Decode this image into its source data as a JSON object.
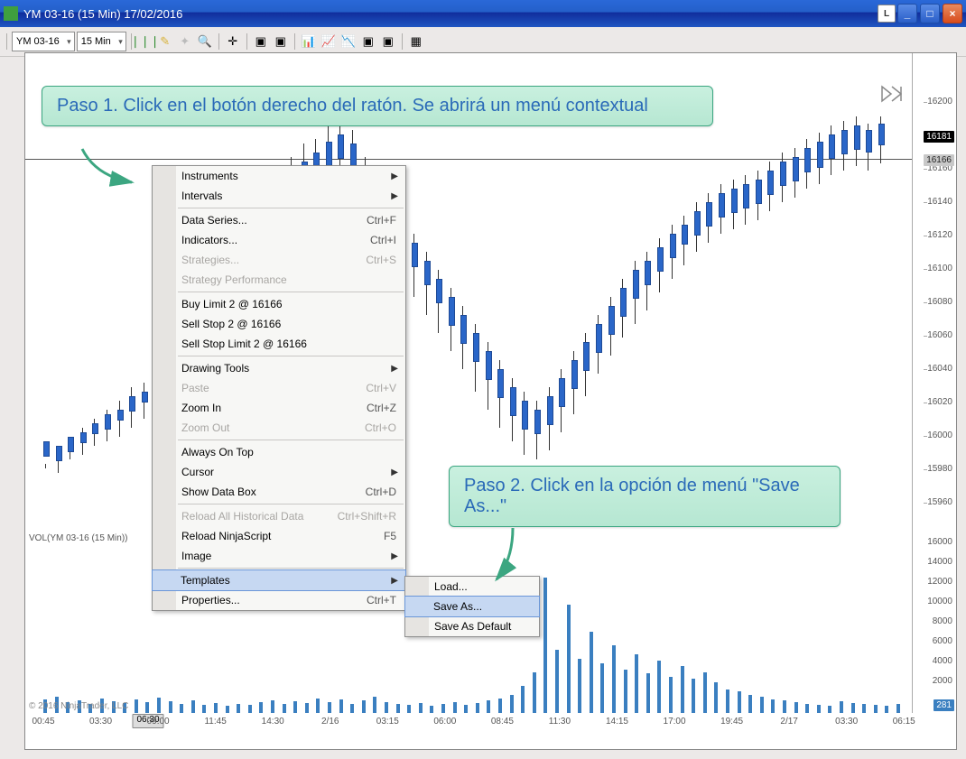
{
  "title": "YM 03-16 (15 Min)  17/02/2016",
  "l_button": "L",
  "toolbar": {
    "instrument": "YM 03-16",
    "interval": "15 Min"
  },
  "chart": {
    "price_current": "16181",
    "price_line": "16166",
    "vol_current": "281",
    "vol_title": "VOL(YM 03-16 (15 Min))",
    "copyright": "© 2016 NinjaTrader, LLC"
  },
  "y_ticks": [
    "16200",
    "16180",
    "16160",
    "16140",
    "16120",
    "16100",
    "16080",
    "16060",
    "16040",
    "16020",
    "16000",
    "15980",
    "15960"
  ],
  "vol_ticks": [
    "16000",
    "14000",
    "12000",
    "10000",
    "8000",
    "6000",
    "4000",
    "2000"
  ],
  "x_ticks": [
    "00:45",
    "03:30",
    "09:00",
    "11:45",
    "14:30",
    "2/16",
    "03:15",
    "06:00",
    "08:45",
    "11:30",
    "14:15",
    "17:00",
    "19:45",
    "2/17",
    "03:30",
    "06:15"
  ],
  "x_cursor": "06:30",
  "menu": {
    "items": [
      {
        "label": "Instruments",
        "arrow": true
      },
      {
        "label": "Intervals",
        "arrow": true
      },
      {
        "sep": true
      },
      {
        "label": "Data Series...",
        "sc": "Ctrl+F"
      },
      {
        "label": "Indicators...",
        "sc": "Ctrl+I"
      },
      {
        "label": "Strategies...",
        "sc": "Ctrl+S",
        "disabled": true
      },
      {
        "label": "Strategy Performance",
        "disabled": true
      },
      {
        "sep": true
      },
      {
        "label": "Buy Limit 2 @ 16166"
      },
      {
        "label": "Sell Stop 2 @ 16166"
      },
      {
        "label": "Sell Stop Limit 2 @ 16166"
      },
      {
        "sep": true
      },
      {
        "label": "Drawing Tools",
        "arrow": true
      },
      {
        "label": "Paste",
        "sc": "Ctrl+V",
        "disabled": true
      },
      {
        "label": "Zoom In",
        "sc": "Ctrl+Z"
      },
      {
        "label": "Zoom Out",
        "sc": "Ctrl+O",
        "disabled": true
      },
      {
        "sep": true
      },
      {
        "label": "Always On Top"
      },
      {
        "label": "Cursor",
        "arrow": true
      },
      {
        "label": "Show Data Box",
        "sc": "Ctrl+D"
      },
      {
        "sep": true
      },
      {
        "label": "Reload All Historical Data",
        "sc": "Ctrl+Shift+R",
        "disabled": true
      },
      {
        "label": "Reload NinjaScript",
        "sc": "F5"
      },
      {
        "label": "Image",
        "arrow": true
      },
      {
        "sep": true
      },
      {
        "label": "Templates",
        "arrow": true,
        "selected": true
      },
      {
        "label": "Properties...",
        "sc": "Ctrl+T"
      }
    ]
  },
  "submenu": {
    "items": [
      {
        "label": "Load..."
      },
      {
        "label": "Save As...",
        "selected": true
      },
      {
        "label": "Save As Default"
      }
    ]
  },
  "callout1": "Paso 1. Click en el botón derecho del ratón. Se abrirá un menú contextual",
  "callout2": "Paso 2. Click en la opción de menú \"Save As...\""
}
